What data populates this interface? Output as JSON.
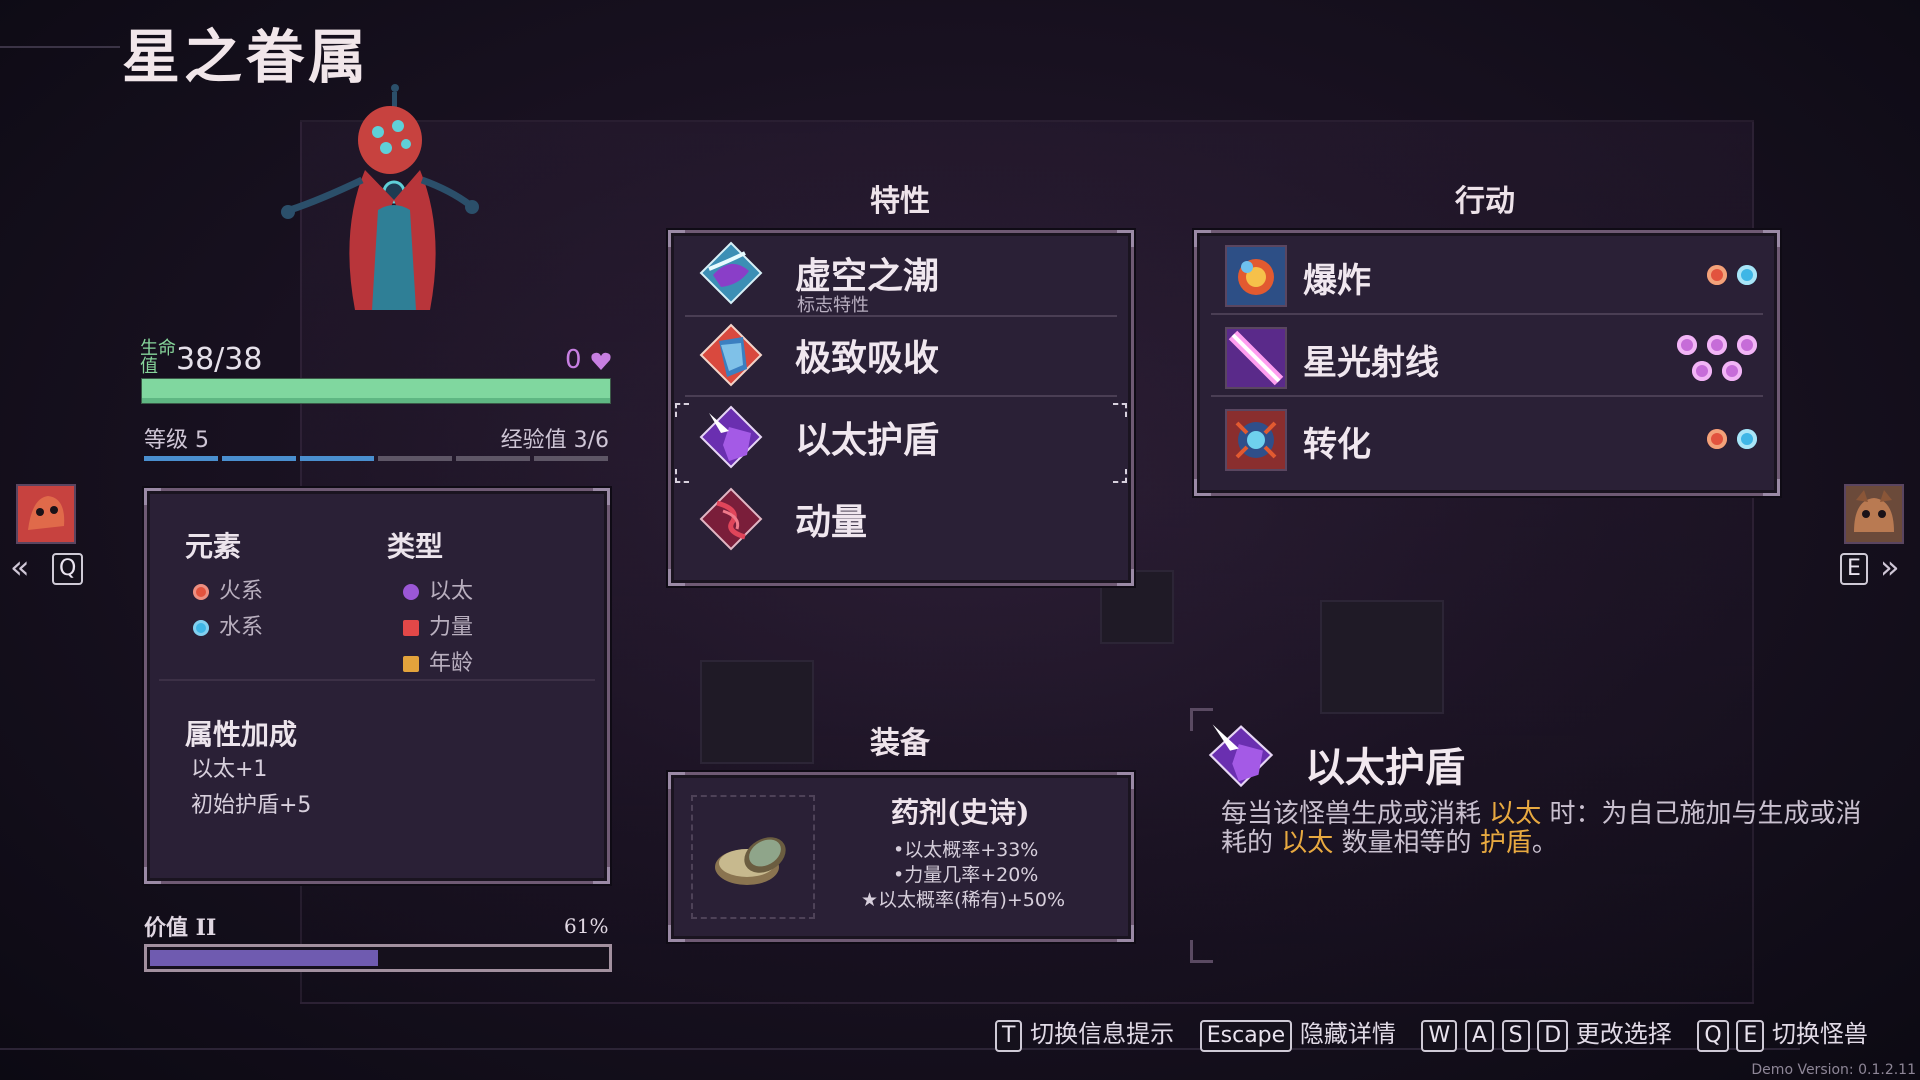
{
  "monster_name": "星之眷属",
  "stats": {
    "hp_label": "生命值",
    "hp_value": "38/38",
    "shield_value": "0",
    "level_text": "等级 5",
    "xp_text": "经验值 3/6",
    "xp_progress_segments": {
      "filled": 3,
      "total": 6
    }
  },
  "info": {
    "element_header": "元素",
    "elements": [
      {
        "name": "火系",
        "color": "#e2533e"
      },
      {
        "name": "水系",
        "color": "#3fb6e6"
      }
    ],
    "type_header": "类型",
    "types": [
      {
        "name": "以太",
        "color": "#9b57d6"
      },
      {
        "name": "力量",
        "color": "#e24848"
      },
      {
        "name": "年龄",
        "color": "#e3a33c"
      }
    ],
    "bonus_header": "属性加成",
    "bonuses": [
      "以太+1",
      "初始护盾+5"
    ]
  },
  "value": {
    "label": "价值 II",
    "percent_text": "61%",
    "fill_fraction": 0.5
  },
  "nav": {
    "prev_key": "Q",
    "next_key": "E"
  },
  "traits": {
    "header": "特性",
    "items": [
      {
        "name": "虚空之潮",
        "subtitle": "标志特性",
        "icon": "void-tide-icon"
      },
      {
        "name": "极致吸收",
        "subtitle": "",
        "icon": "absorb-icon"
      },
      {
        "name": "以太护盾",
        "subtitle": "",
        "icon": "aether-shield-icon",
        "selected": true
      },
      {
        "name": "动量",
        "subtitle": "",
        "icon": "momentum-icon"
      }
    ]
  },
  "actions": {
    "header": "行动",
    "items": [
      {
        "name": "爆炸",
        "icon": "explosion-icon",
        "costs": [
          "fire",
          "water"
        ]
      },
      {
        "name": "星光射线",
        "icon": "starlight-ray-icon",
        "costs": [
          "aether",
          "aether",
          "aether",
          "aether",
          "aether"
        ]
      },
      {
        "name": "转化",
        "icon": "transform-icon",
        "costs": [
          "fire",
          "water"
        ]
      }
    ]
  },
  "equipment": {
    "header": "装备",
    "name": "药剂(史诗)",
    "lines": [
      "•以太概率+33%",
      "•力量几率+20%",
      "★以太概率(稀有)+50%"
    ],
    "icon": "potion-icon"
  },
  "detail": {
    "title": "以太护盾",
    "desc_part1": "每当该怪兽生成或消耗 ",
    "desc_hl1": "以太",
    "desc_part2": " 时：为自己施加与生成或消耗的 ",
    "desc_hl2": "以太",
    "desc_part3": " 数量相等的 ",
    "desc_hl3": "护盾",
    "desc_part4": "。"
  },
  "footer": {
    "toggle_key": "T",
    "toggle_text": "切换信息提示",
    "escape_key": "Escape",
    "escape_text": "隐藏详情",
    "move_keys": [
      "W",
      "A",
      "S",
      "D"
    ],
    "move_text": "更改选择",
    "switch_keys": [
      "Q",
      "E"
    ],
    "switch_text": "切换怪兽"
  },
  "version": "Demo Version: 0.1.2.11",
  "colors": {
    "fire": "#e2533e",
    "water": "#3fb6e6",
    "aether": "#c66cd8",
    "highlight": "#e8a940"
  }
}
